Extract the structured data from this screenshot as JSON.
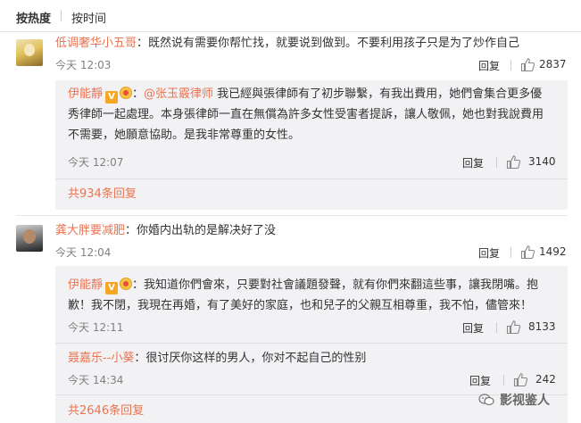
{
  "sort_tabs": {
    "by_heat": "按热度",
    "by_time": "按时间"
  },
  "comments": [
    {
      "user": "低调奢华小五哥",
      "colon": "：",
      "text": "既然说有需要你帮忙找，就要说到做到。不要利用孩子只是为了炒作自己",
      "time": "今天 12:03",
      "reply_label": "回复",
      "likes": "2837",
      "replies": [
        {
          "user": "伊能靜",
          "verified_badge": "V",
          "colon": "：",
          "mention": "@张玉霰律师",
          "text_line1": " 我已經與張律師有了初步聯繫，有我出費用，她們會集合更多優",
          "text_line2": "秀律師一起處理。本身張律師一直在無償為許多女性受害者提訴，讓人敬佩，她也對我說費用",
          "text_line3": "不需要，她願意協助。是我非常尊重的女性。",
          "time": "今天 12:07",
          "reply_label": "回复",
          "likes": "3140"
        }
      ],
      "more_replies": "共934条回复"
    },
    {
      "user": "龚大胖要减肥",
      "colon": "：",
      "text": "你婚内出轨的是解决好了没",
      "time": "今天 12:04",
      "reply_label": "回复",
      "likes": "1492",
      "replies": [
        {
          "user": "伊能靜",
          "verified_badge": "V",
          "colon": "：",
          "text_line1": "我知道你們會來，只要對社會議題發聲，就有你們來翻這些事，讓我閉嘴。抱",
          "text_line2": "歉！我不閉，我現在再婚，有了美好的家庭，也和兒子的父親互相尊重，我不怕，儘管來！",
          "time": "今天 12:11",
          "reply_label": "回复",
          "likes": "8133"
        },
        {
          "user": "聂嘉乐--小葵",
          "colon": "：",
          "text": "很讨厌你这样的男人，你对不起自己的性别",
          "time": "今天 14:34",
          "reply_label": "回复",
          "likes": "242"
        }
      ],
      "more_replies": "共2646条回复"
    }
  ],
  "watermark": "影视鉴人",
  "colors": {
    "accent_orange": "#eb7350",
    "reply_bg": "#f2f2f5",
    "muted_text": "#808080",
    "verified_badge": "#f5a623"
  },
  "icons": {
    "thumb": "thumbs-up-icon",
    "verified": "verified-v-icon",
    "medal": "medal-icon",
    "watermark": "wechat-logo-icon"
  }
}
